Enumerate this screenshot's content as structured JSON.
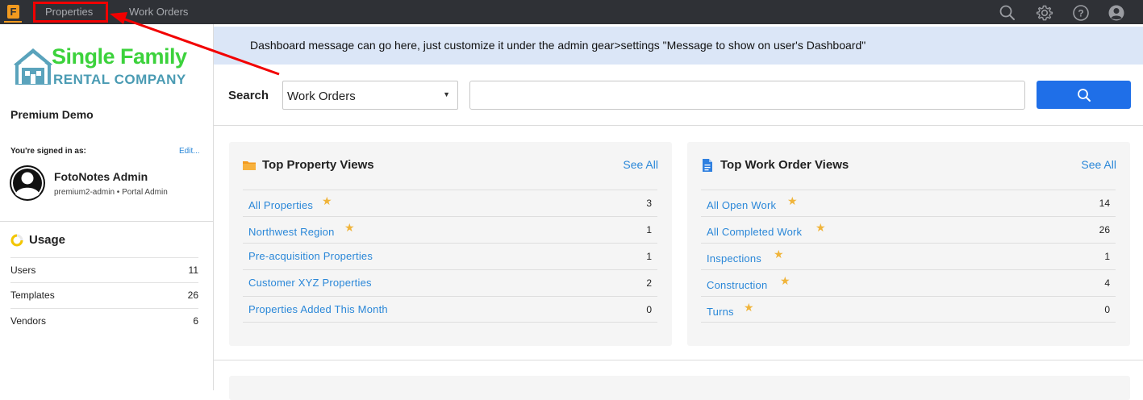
{
  "topnav": {
    "logo_letter": "F",
    "tabs": [
      {
        "label": "Properties"
      },
      {
        "label": "Work Orders"
      }
    ],
    "icons": [
      "search-icon",
      "gear-icon",
      "help-icon",
      "account-icon"
    ]
  },
  "sidebar": {
    "brand": {
      "line1": "Single Family",
      "line2": "RENTAL COMPANY"
    },
    "org_name": "Premium Demo",
    "signed_in_label": "You're signed in as:",
    "edit_label": "Edit...",
    "user": {
      "name": "FotoNotes Admin",
      "subtitle": "premium2-admin • Portal Admin"
    },
    "usage": {
      "title": "Usage",
      "rows": [
        {
          "label": "Users",
          "value": "11"
        },
        {
          "label": "Templates",
          "value": "26"
        },
        {
          "label": "Vendors",
          "value": "6"
        }
      ]
    }
  },
  "message": "Dashboard message can go here, just customize it under the admin gear>settings \"Message to show on user's Dashboard\"",
  "search": {
    "label": "Search",
    "select_value": "Work Orders",
    "input_value": ""
  },
  "property_views": {
    "title": "Top Property Views",
    "see_all": "See All",
    "rows": [
      {
        "label": "All Properties",
        "starred": true,
        "count": "3"
      },
      {
        "label": "Northwest Region",
        "starred": true,
        "count": "1"
      },
      {
        "label": "Pre-acquisition Properties",
        "starred": false,
        "count": "1"
      },
      {
        "label": "Customer XYZ Properties",
        "starred": false,
        "count": "2"
      },
      {
        "label": "Properties Added This Month",
        "starred": false,
        "count": "0"
      }
    ]
  },
  "work_order_views": {
    "title": "Top Work Order Views",
    "see_all": "See All",
    "rows": [
      {
        "label": "All Open Work",
        "starred": true,
        "count": "14"
      },
      {
        "label": "All Completed Work",
        "starred": true,
        "count": "26"
      },
      {
        "label": "Inspections",
        "starred": true,
        "count": "1"
      },
      {
        "label": "Construction",
        "starred": true,
        "count": "4"
      },
      {
        "label": "Turns",
        "starred": true,
        "count": "0"
      }
    ]
  },
  "colors": {
    "topbar": "#2f3136",
    "accent_orange": "#f29a1f",
    "link_blue": "#2a87d8",
    "button_blue": "#1f6fe8",
    "message_bg": "#dbe6f7",
    "brand_green": "#3cd23c",
    "brand_teal": "#4a9bb3",
    "star": "#f0b43a",
    "annotation_red": "#f20000"
  }
}
